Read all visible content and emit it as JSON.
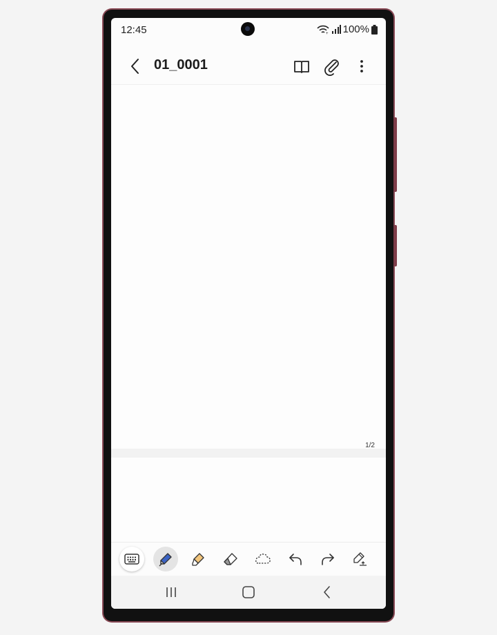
{
  "status": {
    "time": "12:45",
    "battery": "100%"
  },
  "header": {
    "title": "01_0001"
  },
  "page": {
    "indicator": "1/2"
  },
  "colors": {
    "frame": "#8a4a56",
    "pen_blue": "#3b63c4",
    "highlighter": "#f2c57c"
  },
  "icons": {
    "appbar": [
      "back-arrow-icon",
      "book-icon",
      "paperclip-icon",
      "more-vertical-icon"
    ],
    "toolbar": [
      "keyboard-icon",
      "pen-icon",
      "highlighter-icon",
      "eraser-icon",
      "lasso-icon",
      "undo-icon",
      "redo-icon",
      "pen-settings-icon"
    ],
    "nav": [
      "recents-icon",
      "home-icon",
      "back-icon"
    ]
  }
}
